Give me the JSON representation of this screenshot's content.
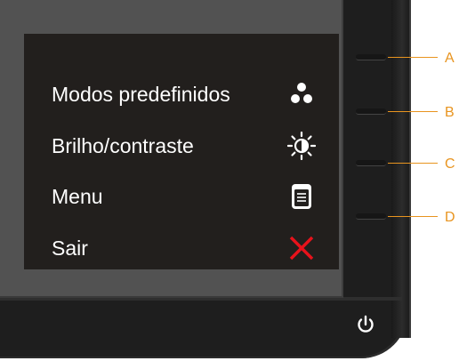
{
  "osd_menu": {
    "items": [
      {
        "label": "Modos predefinidos",
        "icon": "preset-modes-icon",
        "button": "A"
      },
      {
        "label": "Brilho/contraste",
        "icon": "brightness-contrast-icon",
        "button": "B"
      },
      {
        "label": "Menu",
        "icon": "menu-icon",
        "button": "C"
      },
      {
        "label": "Sair",
        "icon": "close-icon",
        "button": "D"
      }
    ]
  },
  "colors": {
    "osd_background": "#221f1d",
    "screen": "#525252",
    "bezel": "#1e1e1e",
    "callout": "#e8941f",
    "exit_icon": "#e8121b",
    "text": "#ffffff"
  },
  "power_icon": "power-icon"
}
